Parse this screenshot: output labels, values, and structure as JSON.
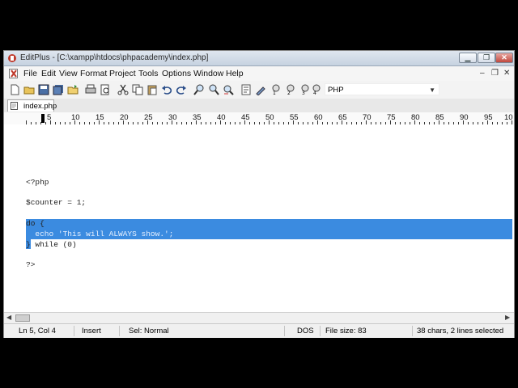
{
  "window": {
    "title": "EditPlus - [C:\\xampp\\htdocs\\phpacademy\\index.php]"
  },
  "menu": {
    "items": [
      "File",
      "Edit",
      "View",
      "Format",
      "Project",
      "Tools",
      "Options",
      "Window",
      "Help"
    ]
  },
  "toolbar": {
    "language": "PHP",
    "icons": [
      "new-file-icon",
      "open-icon",
      "save-icon",
      "save-all-icon",
      "open-folder-icon",
      "print-icon",
      "print-preview-icon",
      "cut-icon",
      "copy-icon",
      "paste-icon",
      "clipboard-icon",
      "undo-icon",
      "redo-icon",
      "find-icon",
      "find-next-icon",
      "replace-icon",
      "word-wrap-icon",
      "spell-check-icon",
      "user-tool-1-icon",
      "user-tool-2-icon",
      "user-tool-3-icon",
      "user-tool-4-icon"
    ]
  },
  "tabs": [
    {
      "label": "index.php"
    }
  ],
  "ruler": {
    "numbers": [
      "5",
      "10",
      "15",
      "20",
      "25",
      "30",
      "35",
      "40",
      "45",
      "50",
      "55",
      "60",
      "65",
      "70",
      "75",
      "80",
      "85",
      "90",
      "95",
      "10"
    ]
  },
  "editor": {
    "lines": [
      "<?php",
      "",
      "$counter = 1;",
      "",
      "do {",
      "  echo 'This will ALWAYS show.';",
      "} while (0)",
      "",
      "?>"
    ],
    "selection_color": "#3b8be0"
  },
  "status": {
    "position": "Ln 5, Col 4",
    "mode": "Insert",
    "sel_mode": "Sel: Normal",
    "line_ending": "DOS",
    "file_size": "File size: 83",
    "selection_info": "38 chars, 2 lines selected"
  }
}
